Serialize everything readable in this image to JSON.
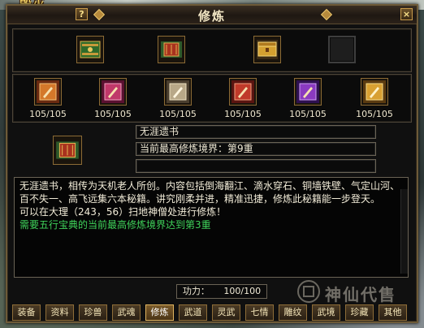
{
  "hud": {
    "label": "毁灭"
  },
  "window": {
    "title": "修炼",
    "help_label": "?",
    "close_label": "×"
  },
  "books_top": [
    {
      "icon": "green-book-icon"
    },
    {
      "icon": "red-scroll-icon"
    },
    {
      "icon": "gold-chest-icon"
    },
    {
      "icon": "empty-slot"
    }
  ],
  "skills": [
    {
      "icon": "orange-scroll-icon",
      "count": "105/105",
      "color": "#d4782a"
    },
    {
      "icon": "pink-scroll-icon",
      "count": "105/105",
      "color": "#c0386a"
    },
    {
      "icon": "white-scroll-icon",
      "count": "105/105",
      "color": "#b8a888"
    },
    {
      "icon": "red-scroll-icon",
      "count": "105/105",
      "color": "#c03a2a"
    },
    {
      "icon": "purple-scroll-icon",
      "count": "105/105",
      "color": "#8a3ac0"
    },
    {
      "icon": "yellow-scroll-icon",
      "count": "105/105",
      "color": "#d8a032"
    }
  ],
  "detail": {
    "book_name": "无涯遗书",
    "realm": "当前最高修炼境界：第9重",
    "extra": ""
  },
  "description": {
    "text": "无涯遗书，相传为天机老人所创。内容包括倒海翻江、滴水穿石、铜墙铁壁、气定山河、百不失一、高飞远集六本秘籍。讲究刚柔并进，精准迅捷，修炼此秘籍能一步登天。",
    "location": "可以在大理（243，56）扫地神僧处进行修炼！",
    "requirement": "需要五行宝典的当前最高修炼境界达到第3重"
  },
  "power": {
    "label": "功力：",
    "value": "100/100"
  },
  "tabs": [
    {
      "label": "装备"
    },
    {
      "label": "资料"
    },
    {
      "label": "珍兽"
    },
    {
      "label": "武魂"
    },
    {
      "label": "修炼",
      "active": true
    },
    {
      "label": "武道"
    },
    {
      "label": "灵武"
    },
    {
      "label": "七情"
    },
    {
      "label": "雕纹"
    },
    {
      "label": "武境"
    },
    {
      "label": "珍藏"
    },
    {
      "label": "其他"
    }
  ],
  "watermark": {
    "text": "神仙代售"
  }
}
